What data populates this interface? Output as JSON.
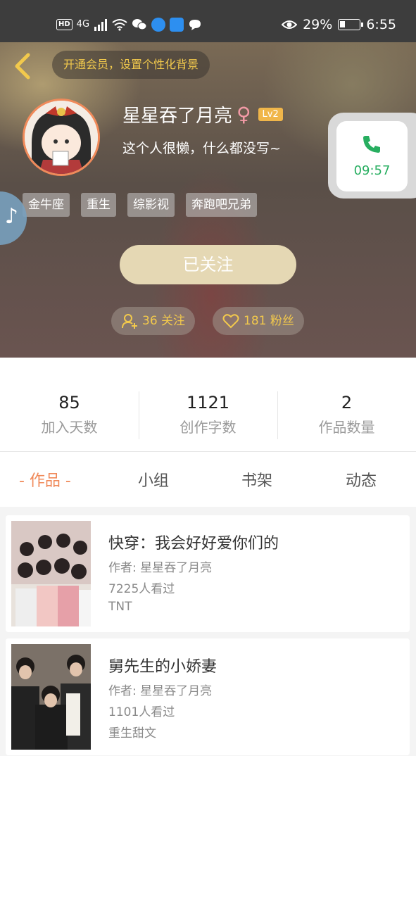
{
  "status_bar": {
    "hd": "HD",
    "network": "4G",
    "battery_percent": "29%",
    "battery_level": 0.29,
    "time": "6:55"
  },
  "header": {
    "back_icon": "chevron-left-icon",
    "vip_banner": "开通会员，设置个性化背景",
    "user_name": "星星吞了月亮",
    "gender_symbol": "♀",
    "level": "Lv2",
    "bio": "这个人很懒，什么都没写~",
    "tags": [
      "金牛座",
      "重生",
      "综影视",
      "奔跑吧兄弟"
    ],
    "follow_button": "已关注",
    "following": "36 关注",
    "fans": "181 粉丝"
  },
  "call_float": {
    "timer": "09:57",
    "color": "#27ae60"
  },
  "stats": [
    {
      "value": "85",
      "label": "加入天数"
    },
    {
      "value": "1121",
      "label": "创作字数"
    },
    {
      "value": "2",
      "label": "作品数量"
    }
  ],
  "tabs": [
    {
      "label": "- 作品 -",
      "active": true
    },
    {
      "label": "小组",
      "active": false
    },
    {
      "label": "书架",
      "active": false
    },
    {
      "label": "动态",
      "active": false
    }
  ],
  "works": [
    {
      "title": "快穿：我会好好爱你们的",
      "author": "作者: 星星吞了月亮",
      "views": "7225人看过",
      "tag": "TNT"
    },
    {
      "title": "舅先生的小娇妻",
      "author": "作者: 星星吞了月亮",
      "views": "1101人看过",
      "tag": "重生甜文"
    }
  ],
  "colors": {
    "accent": "#f08a5a",
    "gold": "#f2c94c",
    "follow_button": "#e5d8b4"
  }
}
